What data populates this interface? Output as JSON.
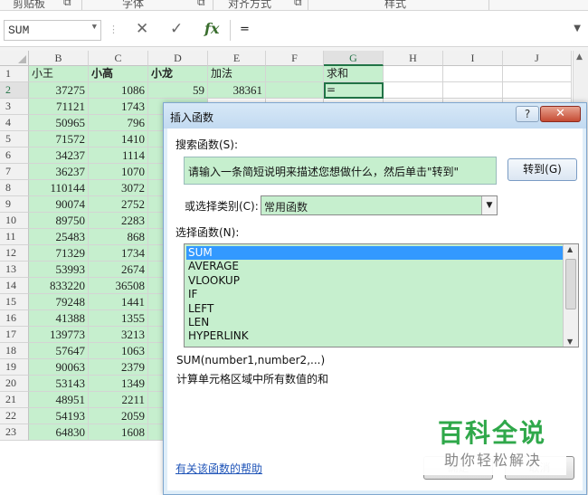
{
  "ribbon": {
    "groups": [
      "剪贴板",
      "字体",
      "对齐方式",
      "样式"
    ]
  },
  "formula_bar": {
    "name_box": "SUM",
    "cancel_icon": "✕",
    "enter_icon": "✓",
    "fx": "fx",
    "content": "="
  },
  "sheet": {
    "columns": [
      "B",
      "C",
      "D",
      "E",
      "F",
      "G",
      "H",
      "I",
      "J"
    ],
    "selected_column": "G",
    "row_numbers": [
      "1",
      "2",
      "3",
      "4",
      "5",
      "6",
      "7",
      "8",
      "9",
      "10",
      "11",
      "12",
      "13",
      "14",
      "15",
      "16",
      "17",
      "18",
      "19",
      "20",
      "21",
      "22",
      "23"
    ],
    "selected_row": "2",
    "header_row": {
      "B": "小王",
      "C": "小高",
      "D": "小龙",
      "E": "加法",
      "G": "求和"
    },
    "row2": {
      "D": "59",
      "E": "38361",
      "G": "="
    },
    "col_B": [
      "37275",
      "71121",
      "50965",
      "71572",
      "34237",
      "36237",
      "110144",
      "90074",
      "89750",
      "25483",
      "71329",
      "53993",
      "833220",
      "79248",
      "41388",
      "139773",
      "57647",
      "90063",
      "53143",
      "48951",
      "54193",
      "64830"
    ],
    "col_C": [
      "1086",
      "1743",
      "796",
      "1410",
      "1114",
      "1070",
      "3072",
      "2752",
      "2283",
      "868",
      "1734",
      "2674",
      "36508",
      "1441",
      "1355",
      "3213",
      "1063",
      "2379",
      "1349",
      "2211",
      "2059",
      "1608"
    ]
  },
  "dialog": {
    "title": "插入函数",
    "help_button": "?",
    "close_button": "✕",
    "search_label": "搜索函数(S):",
    "search_value": "请输入一条简短说明来描述您想做什么，然后单击\"转到\"",
    "goto_button": "转到(G)",
    "category_label": "或选择类别(C):",
    "category_value": "常用函数",
    "function_label": "选择函数(N):",
    "functions": [
      "SUM",
      "AVERAGE",
      "VLOOKUP",
      "IF",
      "LEFT",
      "LEN",
      "HYPERLINK"
    ],
    "selected_function": "SUM",
    "signature": "SUM(number1,number2,...)",
    "description": "计算单元格区域中所有数值的和",
    "help_link": "有关该函数的帮助",
    "ok_button": "确定",
    "cancel_button": "取消"
  },
  "watermark": {
    "title": "百科全说",
    "subtitle": "助你轻松解决"
  },
  "colors": {
    "cell_fill": "#c6efce",
    "excel_green": "#217346",
    "list_selection": "#3399ff"
  }
}
